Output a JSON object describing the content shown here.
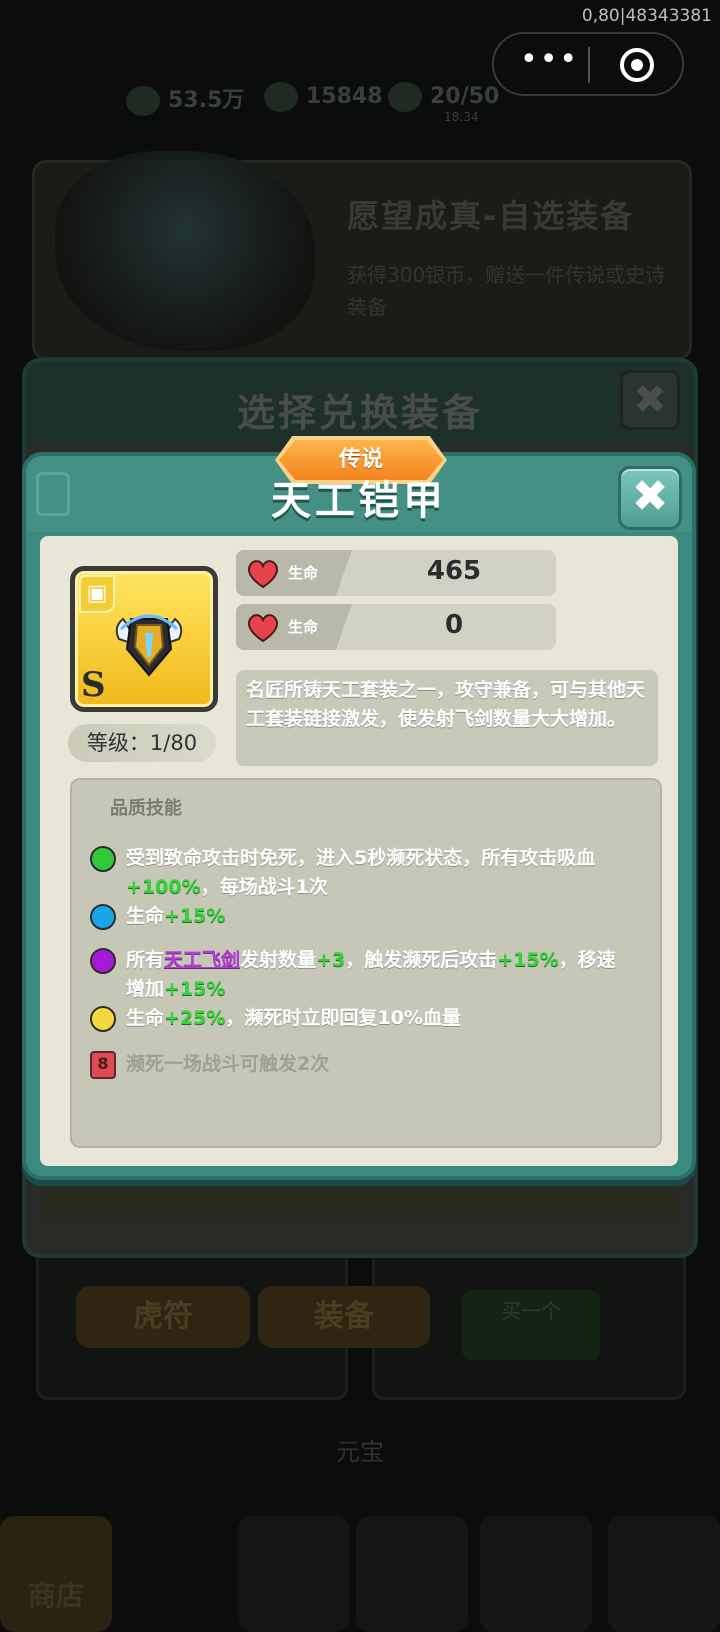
{
  "status_bar": {
    "text": "0,80|48343381"
  },
  "background": {
    "stats": [
      "53.5万",
      "15848",
      "20/50"
    ],
    "stats_sub": "18:34",
    "banner": {
      "title": "愿望成真-自选装备",
      "desc": "获得300银币，赠送一件传说或史诗装备"
    },
    "underlying_dialog_title": "选择兑换装备",
    "buttons": [
      "虎符",
      "装备"
    ],
    "green_button": "买一个",
    "bottom_label": "元宝",
    "tab_shop": "商店"
  },
  "modal": {
    "rarity": "传说",
    "title": "天工铠甲",
    "item": {
      "grade": "S",
      "level_text": "等级：1/80"
    },
    "stats": [
      {
        "label": "生命",
        "value": "465"
      },
      {
        "label": "生命",
        "value": "0"
      }
    ],
    "description": "名匠所铸天工套装之一，攻守兼备，可与其他天工套装链接激发，使发射飞剑数量大大增加。",
    "skills_title": "品质技能",
    "skills": [
      {
        "color": "#2fc93a",
        "parts": [
          "受到致命攻击时免死，进入5秒濒死状态，所有攻击吸血",
          "+100%",
          "，每场战斗1次"
        ]
      },
      {
        "color": "#19a6e8",
        "parts": [
          "生命",
          "+15%"
        ]
      },
      {
        "color": "#a51ad6",
        "parts": [
          "所有",
          "天工飞剑",
          "发射数量",
          "+3",
          "，触发濒死后攻击",
          "+15%",
          "，移速增加",
          "+15%"
        ]
      },
      {
        "color": "#f4d93e",
        "parts": [
          "生命",
          "+25%",
          "，濒死时立即回复10%血量"
        ]
      }
    ],
    "locked_skill": {
      "badge": "8",
      "text": "濒死一场战斗可触发2次"
    }
  },
  "colors": {
    "accent": "#3a8a80",
    "rarity": "#f2841e",
    "highlight": "#36d23a"
  }
}
